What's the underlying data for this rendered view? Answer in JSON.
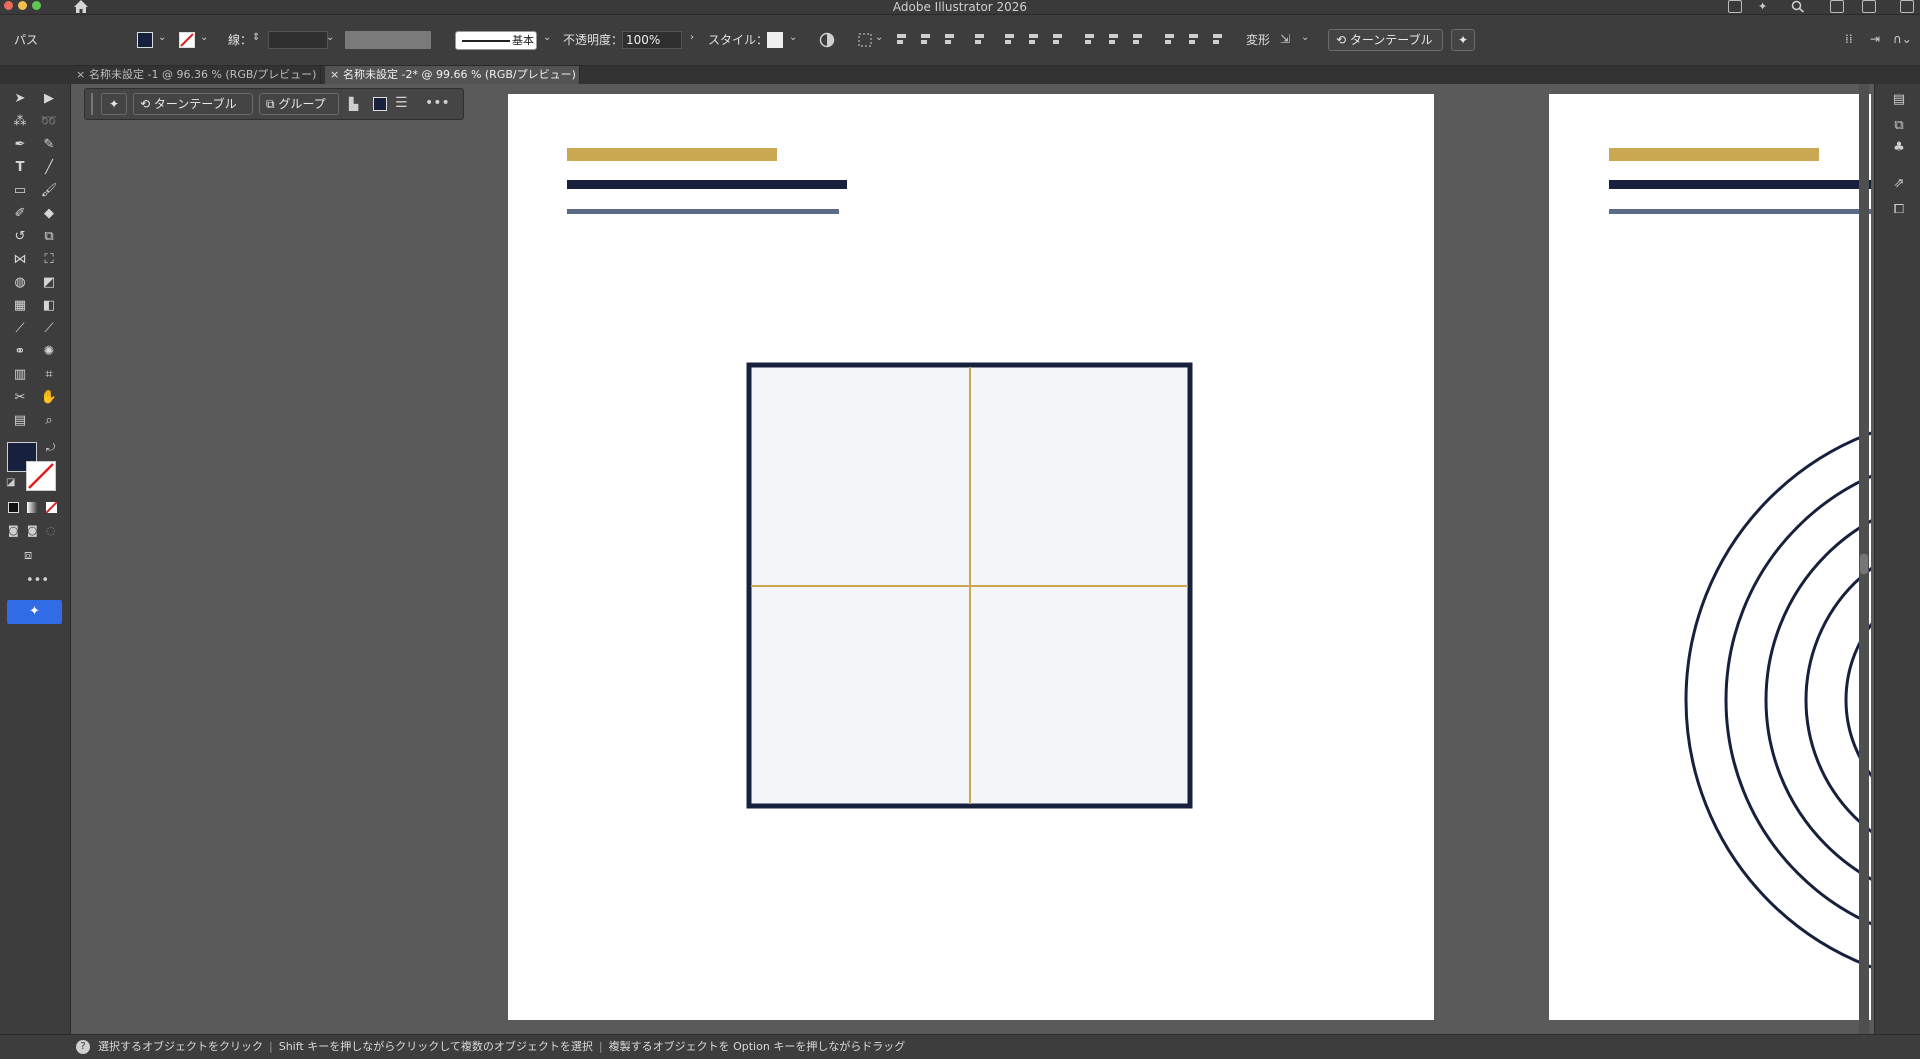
{
  "app": {
    "title": "Adobe Illustrator 2026"
  },
  "control_bar": {
    "selection_label": "パス",
    "stroke_label": "線：",
    "stroke_style_label": "基本",
    "opacity_label": "不透明度：",
    "opacity_value": "100%",
    "style_label": "スタイル：",
    "transform_label": "変形",
    "turntable_label": "ターンテーブル"
  },
  "tabs": [
    {
      "label": "名称未設定 -1 @ 96.36 % (RGB/プレビュー)"
    },
    {
      "label": "名称未設定 -2* @ 99.66 % (RGB/プレビュー)"
    }
  ],
  "float_bar": {
    "turntable_label": "ターンテーブル",
    "group_label": "グループ"
  },
  "status_bar": {
    "hint_1": "選択するオブジェクトをクリック",
    "hint_2": "Shift キーを押しながらクリックして複数のオブジェクトを選択",
    "hint_3": "複製するオブジェクトを Option キーを押しながらドラッグ"
  },
  "colors": {
    "navy": "#17213d",
    "gold": "#c9a851",
    "slate": "#5b6b86",
    "artboard": "#ffffff",
    "tile_fill": "#f4f5f9",
    "accent_blue": "#2f6ce5"
  }
}
